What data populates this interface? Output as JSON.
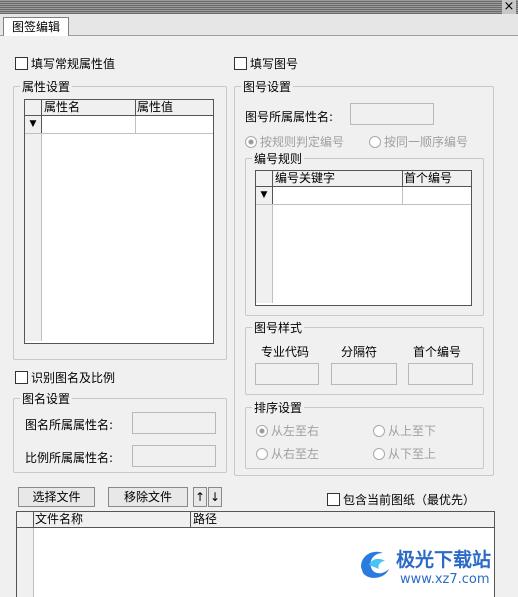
{
  "window": {
    "close_glyph": "×"
  },
  "tab": {
    "label": "图签编辑"
  },
  "left": {
    "fill_regular_checkbox": "填写常规属性值",
    "attr_group_title": "属性设置",
    "attr_columns": [
      "属性名",
      "属性值"
    ],
    "identify_checkbox": "识别图名及比例",
    "drawing_group_title": "图名设置",
    "drawing_name_label": "图名所属属性名:",
    "scale_label": "比例所属属性名:"
  },
  "right": {
    "fill_number_checkbox": "填写图号",
    "number_group_title": "图号设置",
    "number_attr_label": "图号所属属性名:",
    "radio_rule": "按规则判定编号",
    "radio_sequence": "按同一顺序编号",
    "rule_group_title": "编号规则",
    "rule_columns": [
      "编号关键字",
      "首个编号"
    ],
    "style_group_title": "图号样式",
    "style_cols": [
      "专业代码",
      "分隔符",
      "首个编号"
    ],
    "sort_group_title": "排序设置",
    "sort_options": [
      "从左至右",
      "从上至下",
      "从右至左",
      "从下至上"
    ]
  },
  "files": {
    "select_button": "选择文件",
    "remove_button": "移除文件",
    "up_arrow": "↑",
    "down_arrow": "↓",
    "include_current_checkbox": "包含当前图纸（最优先）",
    "columns": [
      "文件名称",
      "路径"
    ]
  },
  "watermark": {
    "brand": "极光下载站",
    "url": "www.xz7.com"
  }
}
